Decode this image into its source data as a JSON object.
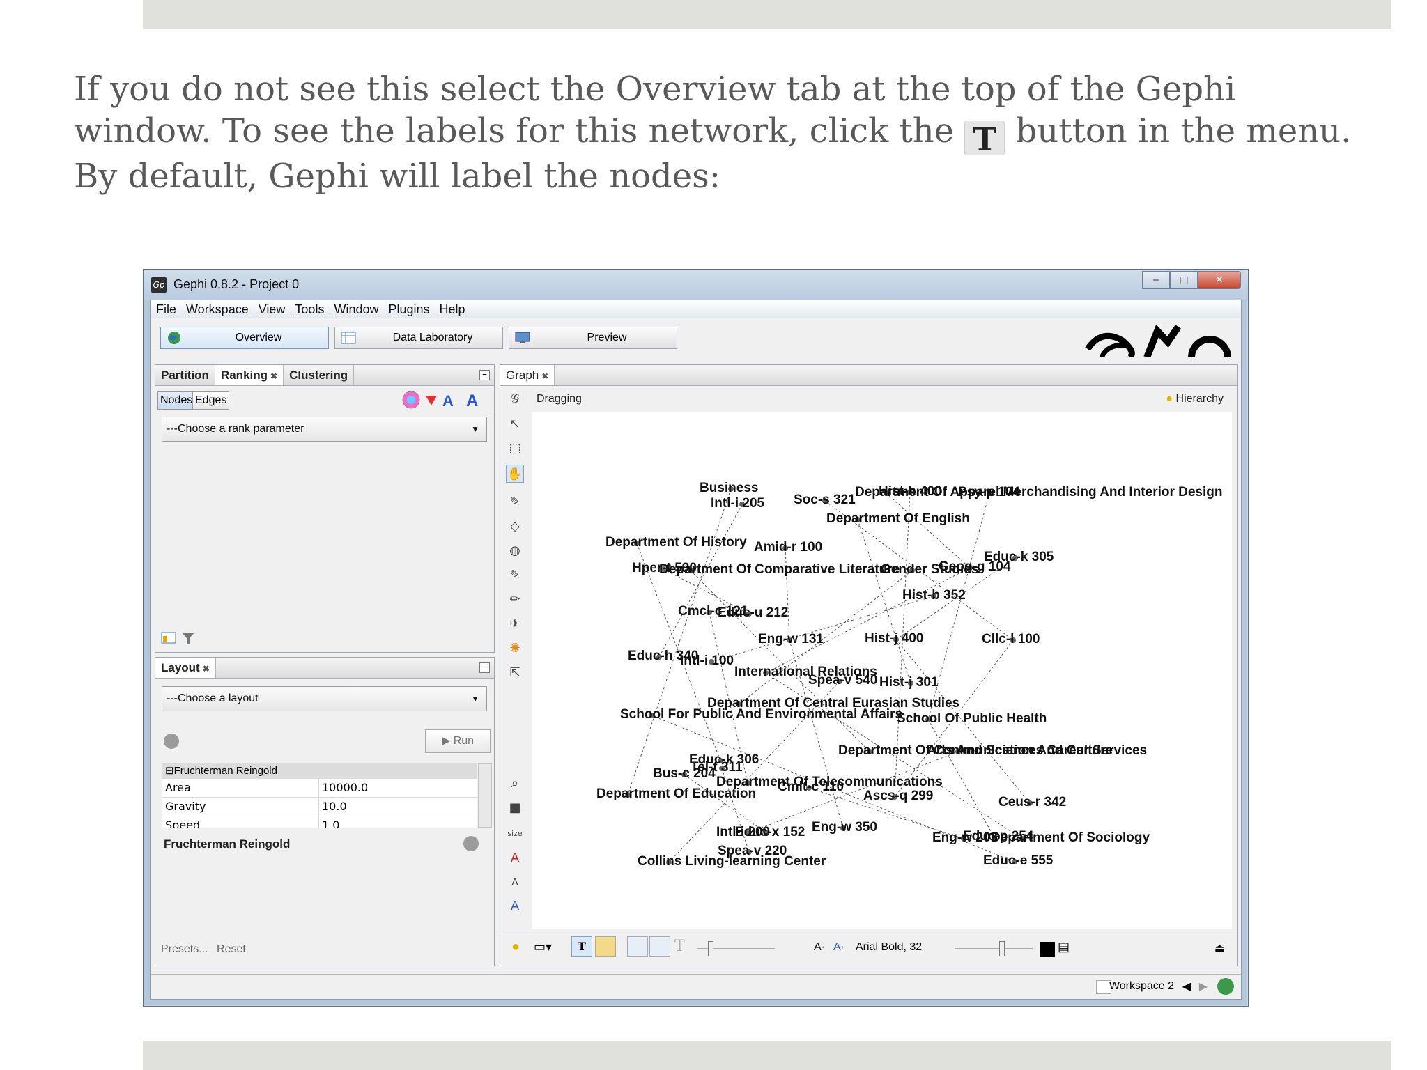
{
  "instructions": {
    "part1": "If you do not see this select the Overview tab at the top of the Gephi window. To see the labels for this network, click the",
    "icon_glyph": "T",
    "part2": "button in the menu. By default, Gephi will label the nodes:"
  },
  "window": {
    "title": "Gephi 0.8.2 - Project 0",
    "app_icon": "Gp",
    "controls": [
      "‒",
      "□",
      "✕"
    ]
  },
  "menu": [
    "File",
    "Workspace",
    "View",
    "Tools",
    "Window",
    "Plugins",
    "Help"
  ],
  "perspectives": [
    {
      "label": "Overview",
      "icon": "globe-icon",
      "active": true
    },
    {
      "label": "Data Laboratory",
      "icon": "table-icon",
      "active": false
    },
    {
      "label": "Preview",
      "icon": "monitor-icon",
      "active": false
    }
  ],
  "ranking_panel": {
    "tabs": [
      "Partition",
      "Ranking",
      "Clustering"
    ],
    "close_glyph": "✖",
    "min_glyph": "‒",
    "toggles": [
      "Nodes",
      "Edges"
    ],
    "rank_combo": "---Choose a rank parameter"
  },
  "layout_panel": {
    "tab": "Layout",
    "layout_combo": "---Choose a layout",
    "run_label": "Run",
    "properties_header": "Fruchterman Reingold",
    "properties": [
      {
        "key": "Area",
        "value": "10000.0"
      },
      {
        "key": "Gravity",
        "value": "10.0"
      },
      {
        "key": "Speed",
        "value": "1.0"
      }
    ],
    "description_title": "Fruchterman Reingold",
    "presets": "Presets...",
    "reset": "Reset"
  },
  "graph_panel": {
    "tab": "Graph",
    "mode": "Dragging",
    "hierarchy": "Hierarchy",
    "size_label": "size",
    "font_label": "Arial Bold, 32",
    "text_tool_glyph": "T",
    "font_size_glyph": "A·"
  },
  "node_labels": [
    "Business",
    "Intl-i 205",
    "Soc-s 321",
    "Department Of Apparel Merchandising And Interior Design",
    "Hist-h 400",
    "Psy-p 104",
    "Department Of English",
    "Department Of History",
    "Amid-r 100",
    "Educ-k 305",
    "Hper-t 590",
    "Department Of Comparative Literature",
    "Gender Studies",
    "Geog-g 104",
    "Hist-b 352",
    "Cmcl-c 121",
    "Educ-u 212",
    "Eng-w 131",
    "Hist-j 400",
    "Cllc-l 100",
    "Educ-h 340",
    "Intl-i 100",
    "International Relations",
    "Spea-v 540",
    "Hist-j 301",
    "School For Public And Environmental Affairs",
    "Department Of Central Eurasian Studies",
    "School Of Public Health",
    "Educ-k 306",
    "Bus-c 204",
    "Tel-t 311",
    "Department Of Communication And Culture",
    "Arts And Sciences Career Services",
    "Department Of Telecommunications",
    "Cmlt-c 110",
    "Department Of Education",
    "Ascs-q 299",
    "Ceus-r 342",
    "Intl-i 200",
    "Educ-x 152",
    "Eng-w 350",
    "Eng-w 203",
    "Educ-p 254",
    "Department Of Sociology",
    "Spea-v 220",
    "Collins Living-learning Center",
    "Educ-e 555"
  ],
  "statusbar": {
    "workspace": "Workspace 2"
  },
  "colors": {
    "slide_bar": "#e0e0dc",
    "intro_text": "#595959",
    "window_frame": "#b4c6d9",
    "close_button": "#c8452e",
    "graph_bg": "#ffffff"
  }
}
